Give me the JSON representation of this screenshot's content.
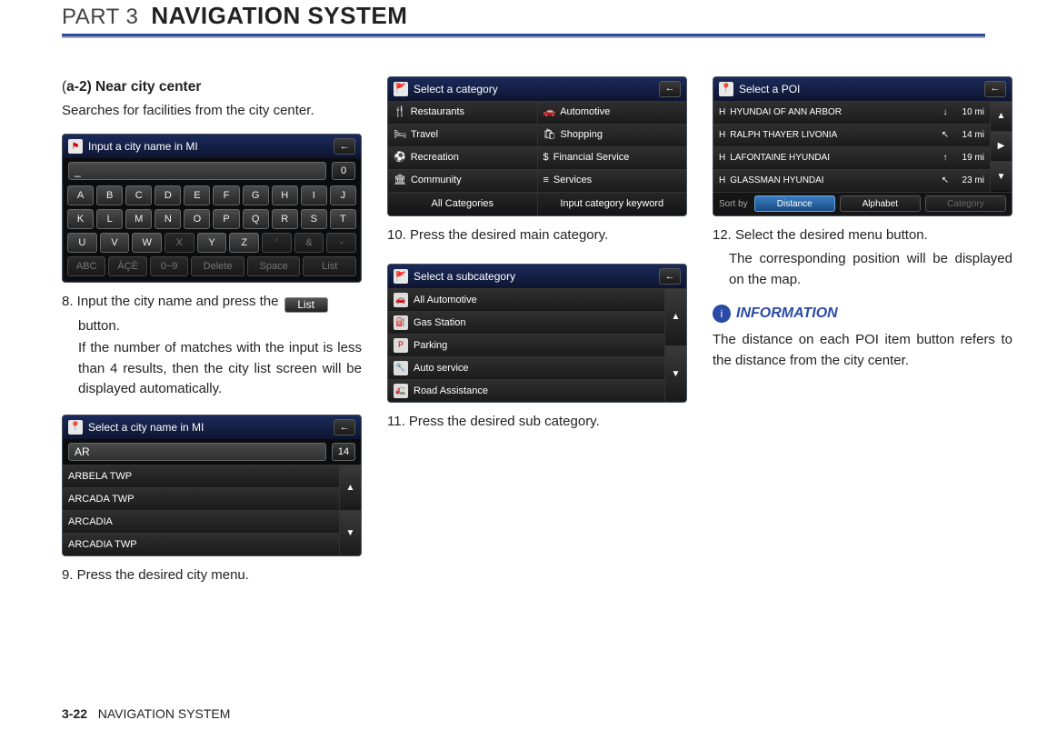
{
  "header": {
    "part": "PART 3",
    "title": "NAVIGATION SYSTEM"
  },
  "col1": {
    "subhead_prefix": "(",
    "subhead_bold": "a-2) Near city center",
    "desc": "Searches for facilities from the city center.",
    "shot1": {
      "title": "Input a city name in MI",
      "input_value": "_",
      "count": "0",
      "rows": [
        [
          "A",
          "B",
          "C",
          "D",
          "E",
          "F",
          "G",
          "H",
          "I",
          "J"
        ],
        [
          "K",
          "L",
          "M",
          "N",
          "O",
          "P",
          "Q",
          "R",
          "S",
          "T"
        ],
        [
          "U",
          "V",
          "W",
          "X",
          "Y",
          "Z",
          "'",
          "&",
          "-"
        ]
      ],
      "dimkeys": [
        "X"
      ],
      "bottom": [
        "ABC",
        "ÀÇÈ",
        "0~9",
        "Delete",
        "Space",
        "List"
      ]
    },
    "step8_a": "8. Input the city name and press the ",
    "step8_btn": "List",
    "step8_b": " button.",
    "step8_note": "If the number of matches with the input is less than 4 results, then the city list screen will be displayed automatically.",
    "shot2": {
      "title": "Select a city name in MI",
      "input_value": "AR",
      "count": "14",
      "items": [
        "ARBELA TWP",
        "ARCADA TWP",
        "ARCADIA",
        "ARCADIA TWP"
      ]
    },
    "step9": "9. Press the desired city menu."
  },
  "col2": {
    "shot1": {
      "title": "Select a category",
      "rows": [
        {
          "l": "Restaurants",
          "r": "Automotive"
        },
        {
          "l": "Travel",
          "r": "Shopping"
        },
        {
          "l": "Recreation",
          "r": "Financial Service"
        },
        {
          "l": "Community",
          "r": "Services"
        }
      ],
      "bottom_l": "All Categories",
      "bottom_r": "Input category keyword"
    },
    "step10": "10. Press the desired main category.",
    "shot2": {
      "title": "Select a subcategory",
      "items": [
        "All Automotive",
        "Gas Station",
        "Parking",
        "Auto service",
        "Road Assistance"
      ]
    },
    "step11": "11. Press the desired sub category."
  },
  "col3": {
    "shot1": {
      "title": "Select a POI",
      "rows": [
        {
          "name": "HYUNDAI OF ANN ARBOR",
          "dir": "↓",
          "dist": "10 mi"
        },
        {
          "name": "RALPH THAYER LIVONIA",
          "dir": "↖",
          "dist": "14 mi"
        },
        {
          "name": "LAFONTAINE HYUNDAI",
          "dir": "↑",
          "dist": "19 mi"
        },
        {
          "name": "GLASSMAN HYUNDAI",
          "dir": "↖",
          "dist": "23 mi"
        }
      ],
      "sort_label": "Sort by",
      "sort_buttons": [
        "Distance",
        "Alphabet",
        "Category"
      ]
    },
    "step12a": "12. Select the desired menu button.",
    "step12b": "The corresponding position will be dis­played on the map.",
    "info_label": "INFORMATION",
    "info_text": "The distance on each POI item button refers to the distance from the city center."
  },
  "footer": {
    "num": "3-22",
    "label": "NAVIGATION SYSTEM"
  }
}
